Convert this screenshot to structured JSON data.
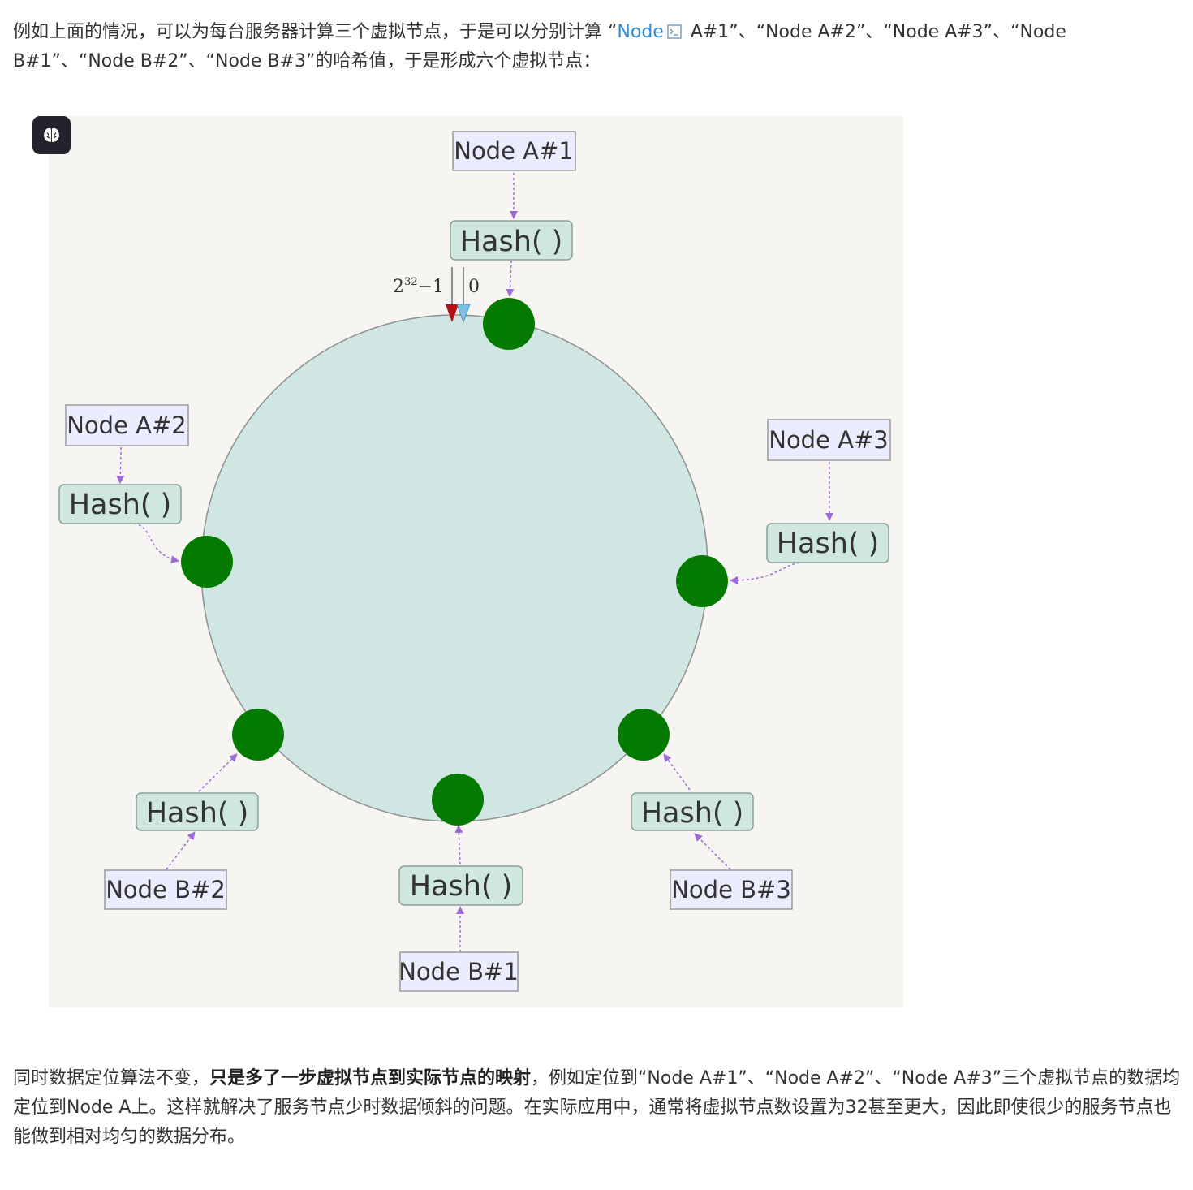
{
  "intro": {
    "before_link": "例如上面的情况，可以为每台服务器计算三个虚拟节点，于是可以分别计算 “",
    "link_text": "Node",
    "link_icon": "terminal-icon",
    "after_link": " A#1”、“Node A#2”、“Node A#3”、“Node B#1”、“Node B#2”、“Node B#3”的哈希值，于是形成六个虚拟节点："
  },
  "figure": {
    "button_icon": "brain-icon",
    "ring_fill": "#d0e6e2",
    "node_color": "#047b00",
    "arrow_color": "#9d6ad8",
    "max_label": "2",
    "max_exponent": "32",
    "max_suffix": "−1",
    "zero_label": "0",
    "nodes": [
      {
        "label": "Node A#1",
        "hash": "Hash( )"
      },
      {
        "label": "Node A#2",
        "hash": "Hash( )"
      },
      {
        "label": "Node A#3",
        "hash": "Hash( )"
      },
      {
        "label": "Node B#1",
        "hash": "Hash( )"
      },
      {
        "label": "Node B#2",
        "hash": "Hash( )"
      },
      {
        "label": "Node B#3",
        "hash": "Hash( )"
      }
    ]
  },
  "conclusion": {
    "part1": "同时数据定位算法不变，",
    "bold": "只是多了一步虚拟节点到实际节点的映射",
    "part2": "，例如定位到“Node A#1”、“Node A#2”、“Node A#3”三个虚拟节点的数据均定位到Node A上。这样就解决了服务节点少时数据倾斜的问题。在实际应用中，通常将虚拟节点数设置为32甚至更大，因此即使很少的服务节点也能做到相对均匀的数据分布。"
  }
}
